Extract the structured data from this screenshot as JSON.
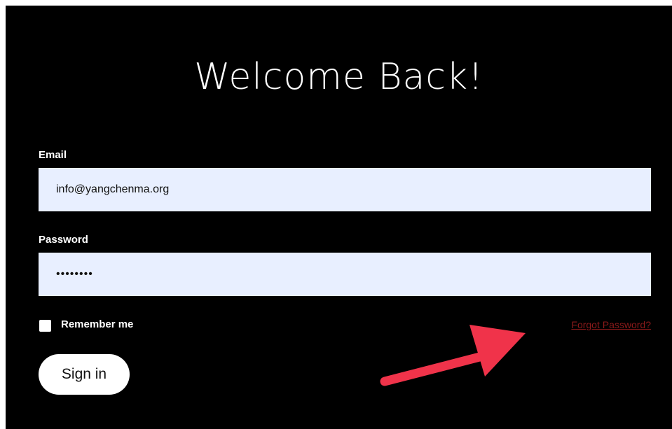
{
  "form": {
    "title": "Welcome Back!",
    "email_label": "Email",
    "email_value": "info@yangchenma.org",
    "password_label": "Password",
    "password_value": "••••••••",
    "remember_label": "Remember me",
    "remember_checked": false,
    "forgot_link": "Forgot Password?",
    "signin_label": "Sign in"
  },
  "colors": {
    "background": "#000000",
    "input_background": "#e8efff",
    "forgot_link": "#8b1a1a",
    "arrow": "#f0334a"
  },
  "annotation": {
    "icon": "arrow-icon"
  }
}
